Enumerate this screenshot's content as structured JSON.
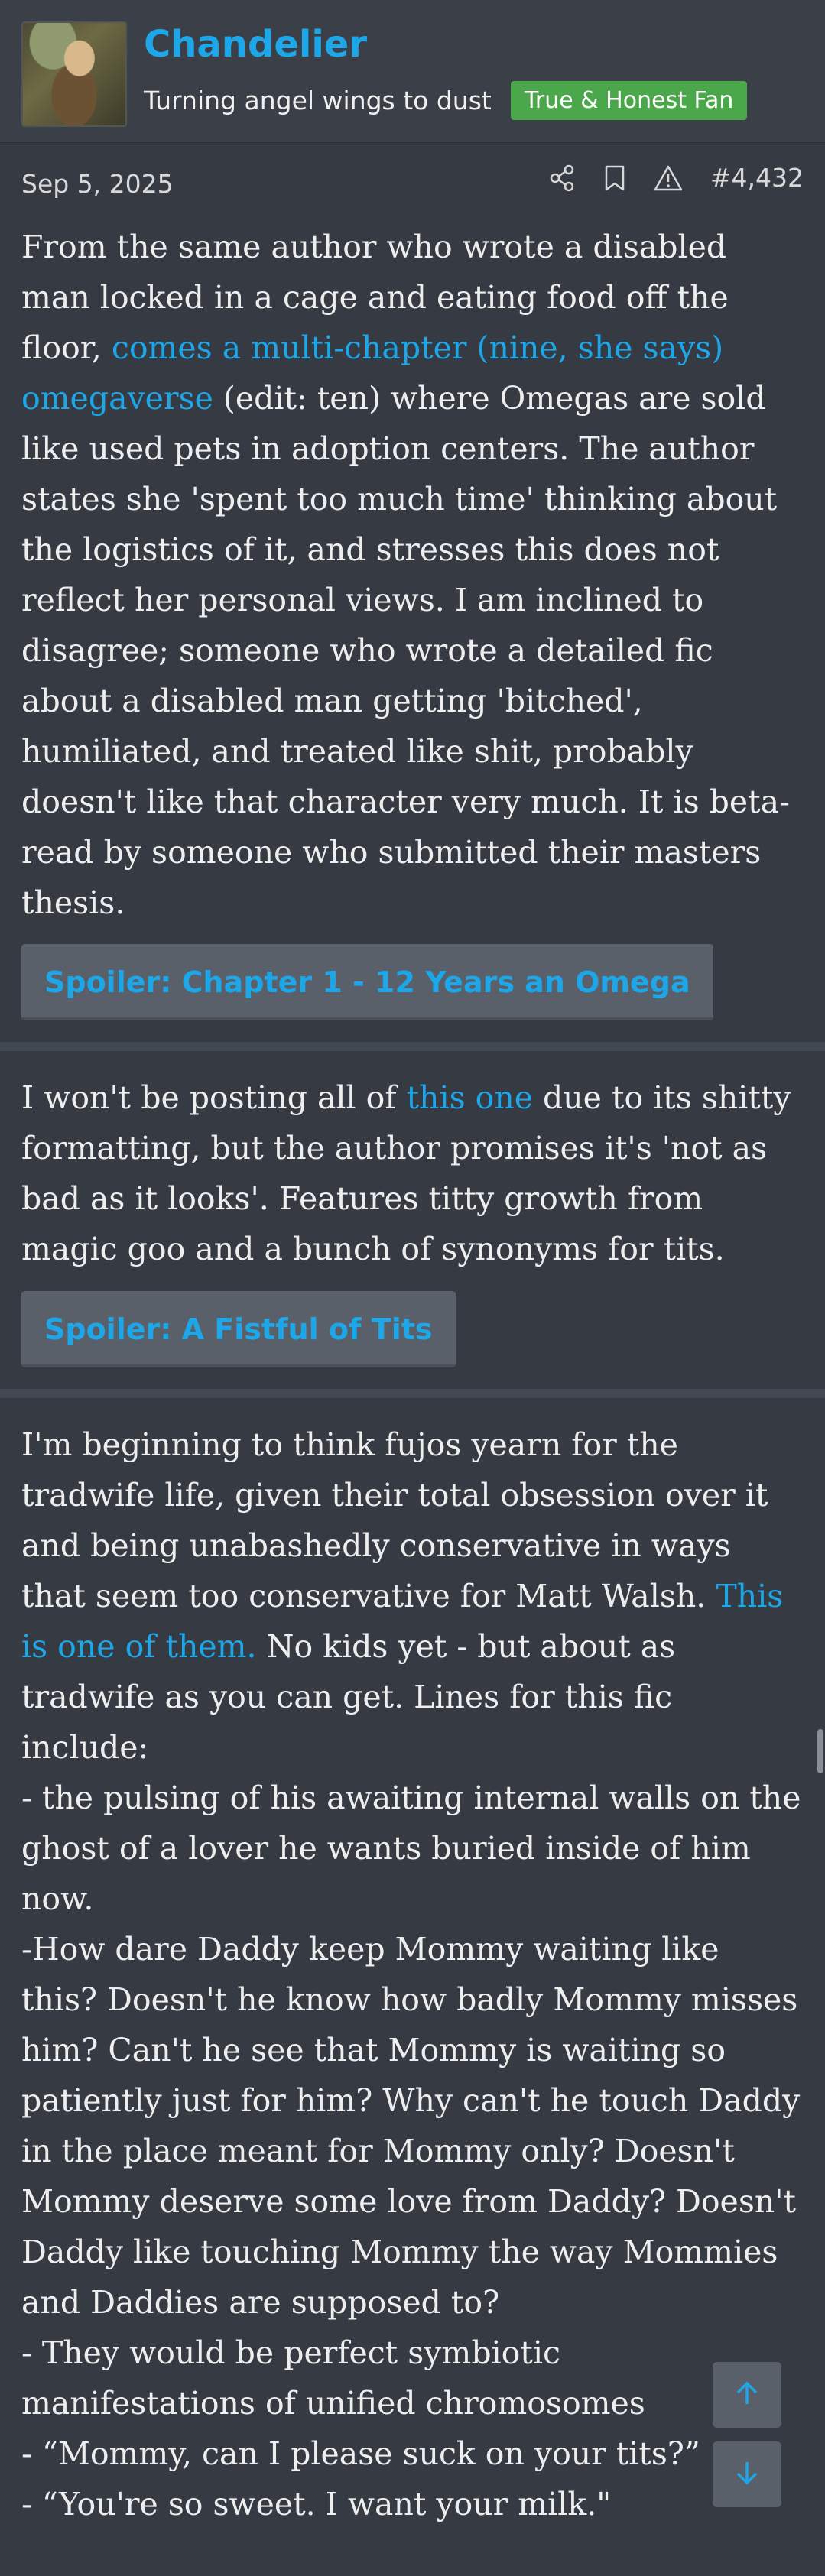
{
  "user": {
    "name": "Chandelier",
    "title": "Turning angel wings to dust",
    "badge": "True & Honest Fan"
  },
  "post": {
    "date": "Sep 5, 2025",
    "number": "#4,432",
    "icons": [
      "share-icon",
      "bookmark-icon",
      "report-icon"
    ]
  },
  "messages": [
    {
      "p1_a": "From the same author who wrote a disabled man locked in a cage and eating food off the floor, ",
      "link": "comes a multi-chapter (nine, she says) omegaverse",
      "p1_b": " (edit: ten) where Omegas are sold like used pets in adoption centers. The author states she 'spent too much time' thinking about the logistics of it, and stresses this does not reflect her personal views. I am inclined to disagree; someone who wrote a detailed fic about a disabled man getting 'bitched', humiliated, and treated like shit, probably doesn't like that character very much. It is beta-read by someone who submitted their masters thesis.",
      "spoiler": "Spoiler: Chapter 1 - 12 Years an Omega"
    },
    {
      "p1_a": "I won't be posting all of ",
      "link": "this one",
      "p1_b": " due to its shitty formatting, but the author promises it's 'not as bad as it looks'. Features titty growth from magic goo and a bunch of synonyms for tits.",
      "spoiler": "Spoiler: A Fistful of Tits"
    },
    {
      "p1_a": "I'm beginning to think fujos yearn for the tradwife life, given their total obsession over it and being unabashedly conservative in ways that seem too conservative for Matt Walsh. ",
      "link": "This is one of them.",
      "p1_b": " No kids yet - but about as tradwife as you can get. Lines for this fic include:",
      "lines": [
        "- the pulsing of his awaiting internal walls on the ghost of a lover he wants buried inside of him now.",
        "-How dare Daddy keep Mommy waiting like this? Doesn't he know how badly Mommy misses him? Can't he see that Mommy is waiting so patiently just for him? Why can't he touch Daddy in the place meant for Mommy only? Doesn't Mommy deserve some love from Daddy? Doesn't Daddy like touching Mommy the way Mommies and Daddies are supposed to?",
        "- They would be perfect symbiotic manifestations of unified chromosomes",
        "- “Mommy, can I please suck on your tits?”",
        "- “You're so sweet. I want your milk.\""
      ]
    }
  ],
  "nav": {
    "up": "arrow-up-icon",
    "down": "arrow-down-icon"
  },
  "colors": {
    "accent": "#1da7e8",
    "badge": "#4aa84a",
    "background": "#2f343c"
  }
}
